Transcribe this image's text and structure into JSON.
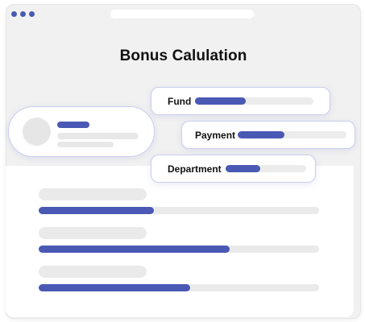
{
  "window": {
    "traffic_light_color": "#4a59b4",
    "title": "Bonus Calulation"
  },
  "accent_color": "#4a59b4",
  "cards": [
    {
      "label": "Fund",
      "progress": 0.43
    },
    {
      "label": "Payment",
      "progress": 0.43
    },
    {
      "label": "Department",
      "progress": 0.43
    }
  ],
  "rows": [
    {
      "progress": 0.41
    },
    {
      "progress": 0.68
    },
    {
      "progress": 0.54
    }
  ]
}
